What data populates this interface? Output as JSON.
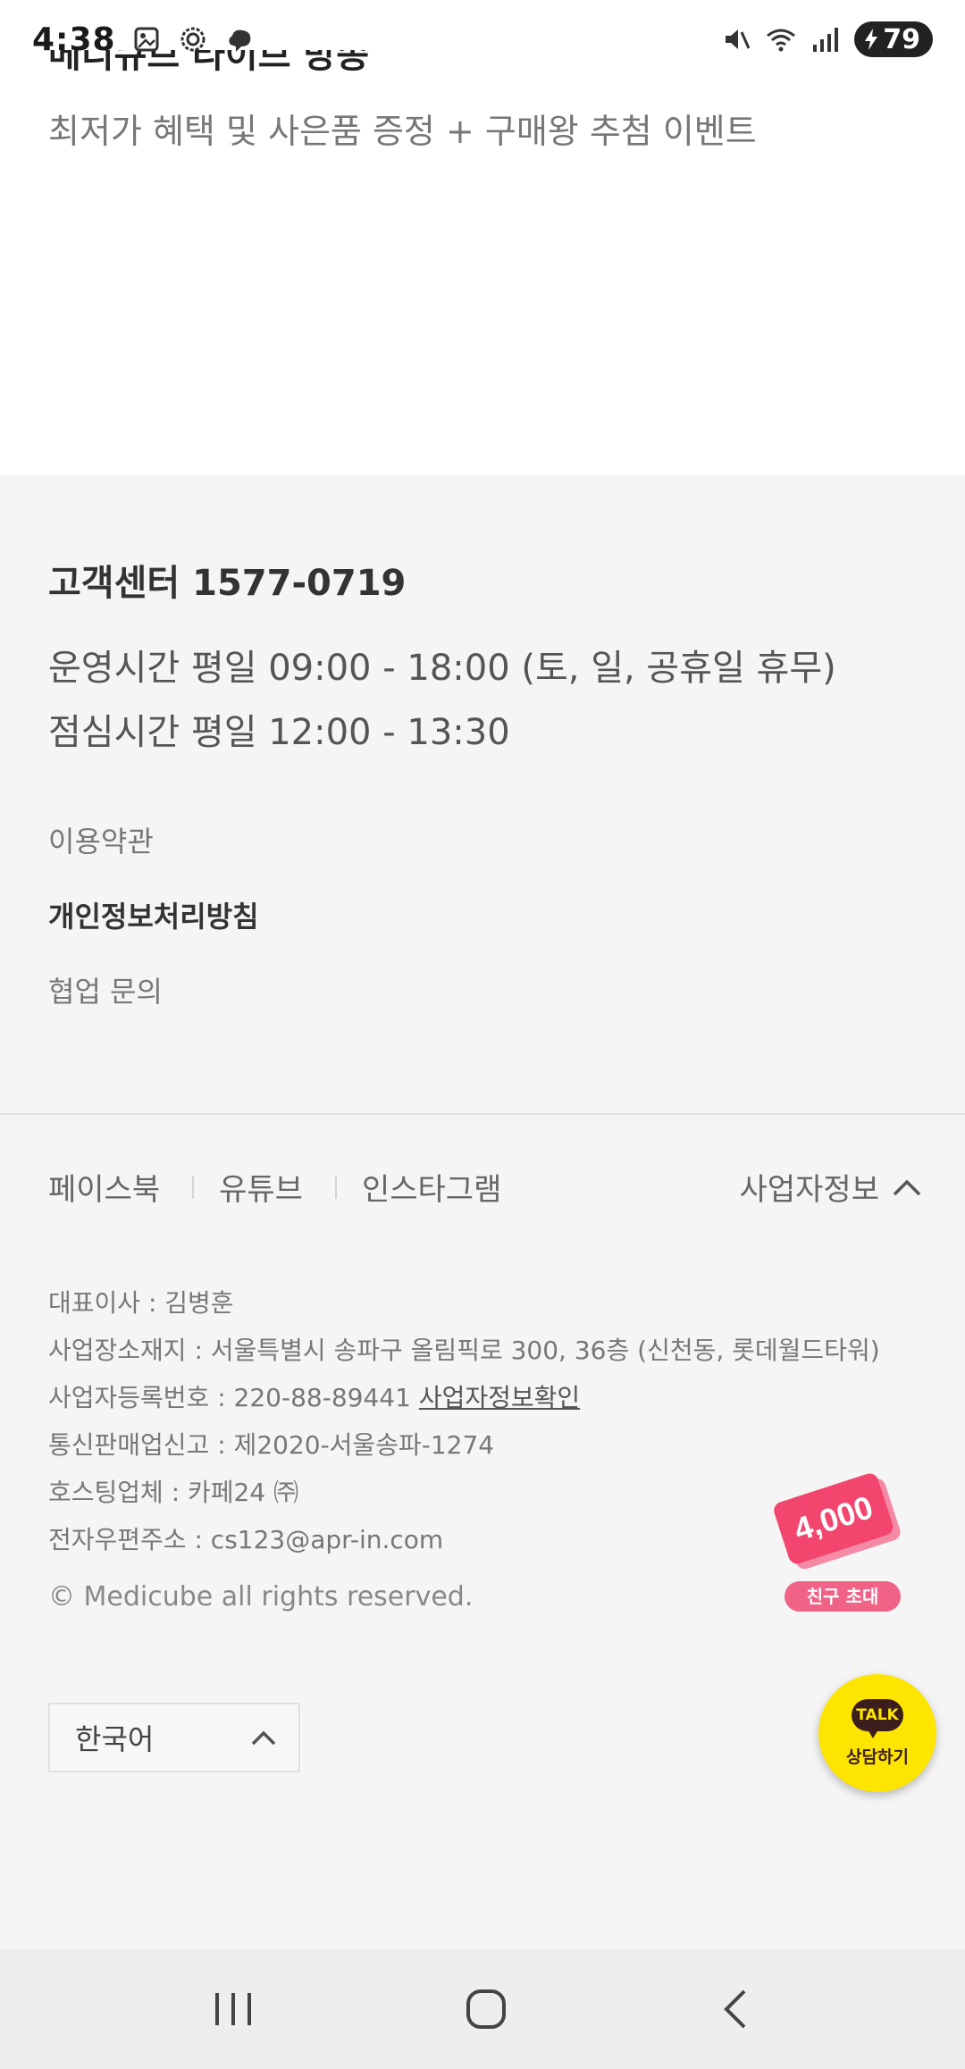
{
  "status_bar": {
    "time": "4:38",
    "battery": "79",
    "icons": [
      "gallery-icon",
      "settings-gear-icon",
      "cloud-icon",
      "mute-icon",
      "wifi-icon",
      "signal-icon"
    ]
  },
  "promo": {
    "title_clipped": "메디큐브 라이브 방송",
    "subtitle": "최저가 혜택 및 사은품 증정 + 구매왕 추첨 이벤트"
  },
  "footer": {
    "cs_title": "고객센터 1577-0719",
    "hours": [
      "운영시간 평일 09:00 - 18:00 (토, 일, 공휴일 휴무)",
      "점심시간 평일 12:00 - 13:30"
    ],
    "links": [
      "이용약관",
      "개인정보처리방침",
      "협업 문의"
    ],
    "social": [
      "페이스북",
      "유튜브",
      "인스타그램"
    ],
    "biz_toggle": "사업자정보",
    "biz_info": [
      "대표이사 : 김병훈",
      "사업장소재지 : 서울특별시 송파구 올림픽로 300, 36층 (신천동, 롯데월드타워)",
      "사업자등록번호 : 220-88-89441",
      "통신판매업신고 : 제2020-서울송파-1274",
      "호스팅업체 : 카페24 ㈜",
      "전자우편주소 : cs123@apr-in.com"
    ],
    "biz_check_link": "사업자정보확인",
    "copyright": "© Medicube all rights reserved.",
    "language": "한국어"
  },
  "floating": {
    "invite_amount": "4,000",
    "invite_label": "친구 초대",
    "talk_badge": "TALK",
    "talk_label": "상담하기"
  },
  "colors": {
    "footer_bg": "#f5f5f5",
    "invite_pink": "#f06286",
    "kakao_yellow": "#fee500",
    "kakao_brown": "#3c1e1e"
  }
}
